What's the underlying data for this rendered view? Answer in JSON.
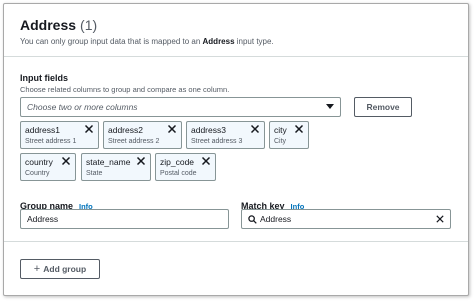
{
  "header": {
    "title": "Address",
    "count": "(1)",
    "subtitle_prefix": "You can only group input data that is mapped to an ",
    "subtitle_bold": "Address",
    "subtitle_suffix": " input type."
  },
  "input_fields": {
    "label": "Input fields",
    "description": "Choose related columns to group and compare as one column.",
    "select_placeholder": "Choose two or more columns",
    "remove_label": "Remove",
    "tokens": [
      {
        "name": "address1",
        "desc": "Street address 1"
      },
      {
        "name": "address2",
        "desc": "Street address 2"
      },
      {
        "name": "address3",
        "desc": "Street address 3"
      },
      {
        "name": "city",
        "desc": "City"
      },
      {
        "name": "country",
        "desc": "Country"
      },
      {
        "name": "state_name",
        "desc": "State"
      },
      {
        "name": "zip_code",
        "desc": "Postal code"
      }
    ]
  },
  "group_name": {
    "label": "Group name",
    "info": "Info",
    "value": "Address"
  },
  "match_key": {
    "label": "Match key",
    "info": "Info",
    "value": "Address"
  },
  "footer": {
    "add_group_label": "Add group"
  },
  "colors": {
    "accent": "#0073bb",
    "token_bg": "#f2f8fd",
    "border": "#879596"
  }
}
